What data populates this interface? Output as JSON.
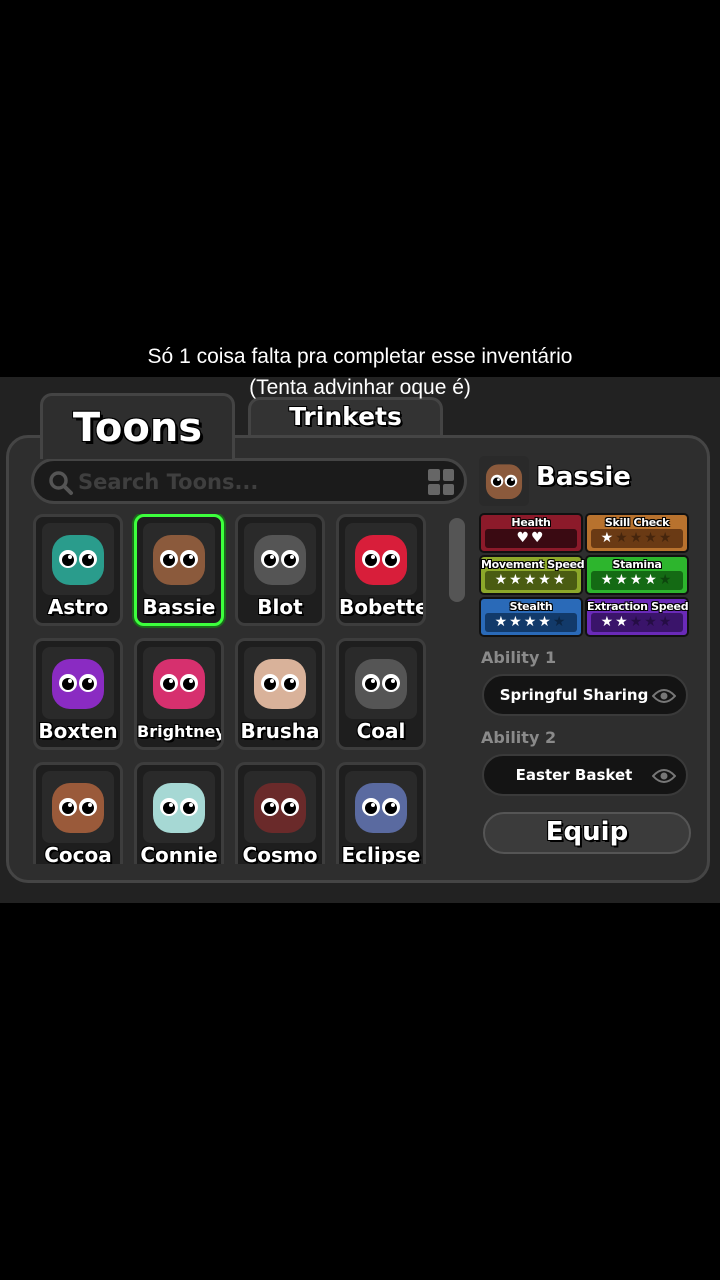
{
  "caption": {
    "line1": "Só 1 coisa falta pra completar esse inventário",
    "line2": "(Tenta advinhar oque é)"
  },
  "tabs": {
    "toons": "Toons",
    "trinkets": "Trinkets"
  },
  "search": {
    "placeholder": "Search Toons..."
  },
  "toons": [
    {
      "name": "Astro",
      "color": "#2a9c8c",
      "bg": "#3a2b66"
    },
    {
      "name": "Bassie",
      "color": "#8b5a3c",
      "bg": "#4a3a3a",
      "selected": true
    },
    {
      "name": "Blot",
      "color": "#555555",
      "bg": "#2a2a2a"
    },
    {
      "name": "Bobette",
      "color": "#d81e3a",
      "bg": "#2a2a2a"
    },
    {
      "name": "Boxten",
      "color": "#8a2bc2",
      "bg": "#3a1a4a"
    },
    {
      "name": "Brightney",
      "color": "#d6306e",
      "bg": "#2a2a2a"
    },
    {
      "name": "Brusha",
      "color": "#d9b29a",
      "bg": "#2a2a2a"
    },
    {
      "name": "Coal",
      "color": "#555555",
      "bg": "#222222"
    },
    {
      "name": "Cocoa",
      "color": "#9a5a3a",
      "bg": "#2a2a2a"
    },
    {
      "name": "Connie",
      "color": "#a6d8d4",
      "bg": "#2a2a2a"
    },
    {
      "name": "Cosmo",
      "color": "#6a2a2a",
      "bg": "#2a2a2a"
    },
    {
      "name": "Eclipse",
      "color": "#5a6aa0",
      "bg": "#2a2a3a"
    }
  ],
  "selected": {
    "name": "Bassie"
  },
  "stats": [
    {
      "label": "Health",
      "color": "#8c1a2a",
      "bar": "#3a0a12",
      "symbol": "♥",
      "filled": 2,
      "total": 2
    },
    {
      "label": "Skill Check",
      "color": "#b8722e",
      "bar": "#6a3a14",
      "symbol": "★",
      "filled": 1,
      "total": 5
    },
    {
      "label": "Movement Speed",
      "color": "#8ca82a",
      "bar": "#4a5c12",
      "symbol": "★",
      "filled": 5,
      "total": 5
    },
    {
      "label": "Stamina",
      "color": "#2db52d",
      "bar": "#146a14",
      "symbol": "★",
      "filled": 4,
      "total": 5
    },
    {
      "label": "Stealth",
      "color": "#2a6ab8",
      "bar": "#123a6a",
      "symbol": "★",
      "filled": 4,
      "total": 5
    },
    {
      "label": "Extraction Speed",
      "color": "#6a2ab8",
      "bar": "#3a146a",
      "symbol": "★",
      "filled": 2,
      "total": 5
    }
  ],
  "abilities": {
    "label1": "Ability 1",
    "value1": "Springful Sharing",
    "label2": "Ability 2",
    "value2": "Easter Basket"
  },
  "equip_label": "Equip"
}
